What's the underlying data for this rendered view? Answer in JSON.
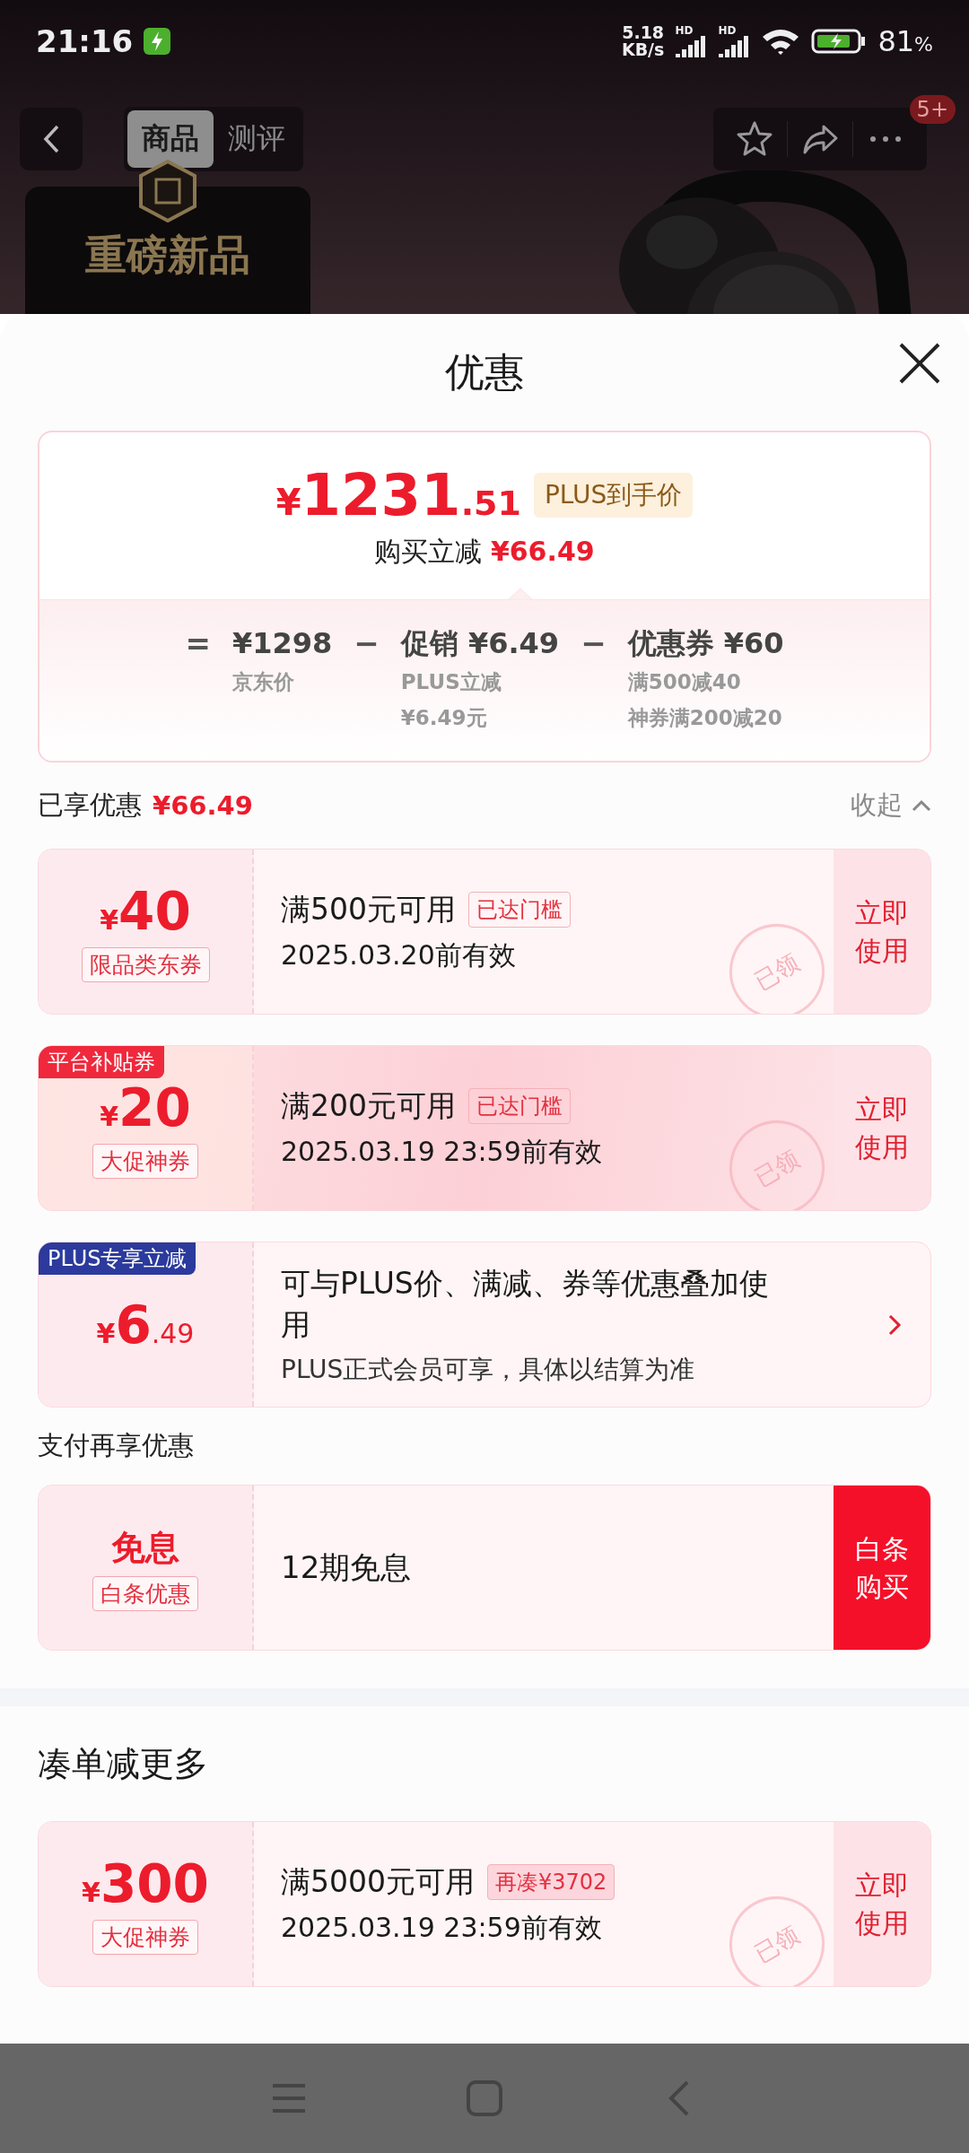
{
  "status_bar": {
    "time": "21:16",
    "net_speed": "5.18",
    "net_unit": "KB/s",
    "signal_labels": [
      "HD",
      "HD"
    ],
    "battery_text": "81",
    "battery_unit": "%"
  },
  "header": {
    "tabs": [
      {
        "label": "商品",
        "selected": true
      },
      {
        "label": "测评",
        "selected": false
      }
    ],
    "promo": "重磅新品",
    "badge": "5+"
  },
  "sheet": {
    "title": "优惠",
    "summary": {
      "currency": "¥",
      "price": "1231",
      "price_decimals": ".51",
      "price_tag": "PLUS到手价",
      "saving_label": "购买立减",
      "saving": "¥66.49",
      "breakdown": [
        {
          "op": "=",
          "value": "¥1298",
          "notes": [
            "京东价"
          ]
        },
        {
          "op": "−",
          "value": "促销 ¥6.49",
          "notes": [
            "PLUS立减",
            "¥6.49元"
          ]
        },
        {
          "op": "−",
          "value": "优惠券 ¥60",
          "notes": [
            "满500减40",
            "神券满200减20"
          ]
        }
      ]
    },
    "enjoyed": {
      "label": "已享优惠",
      "amount": "¥66.49",
      "toggle": "收起",
      "expanded": true
    },
    "offers": [
      {
        "kind": "coupon",
        "currency": "¥",
        "amount": "40",
        "tag": "限品类东券",
        "condition": "满500元可用",
        "badge": {
          "text": "已达门槛",
          "kind": "outline"
        },
        "validity": "2025.03.20前有效",
        "action": "立即使用",
        "stamp": "已领",
        "featured": false
      },
      {
        "kind": "coupon",
        "ribbon": {
          "text": "平台补贴券",
          "color": "#f0283c"
        },
        "currency": "¥",
        "amount": "20",
        "tag": "大促神券",
        "condition": "满200元可用",
        "badge": {
          "text": "已达门槛",
          "kind": "outline"
        },
        "validity": "2025.03.19 23:59前有效",
        "action": "立即使用",
        "stamp": "已领",
        "featured": true
      },
      {
        "kind": "plus",
        "ribbon": {
          "text": "PLUS专享立减",
          "color": "#2b3a9c"
        },
        "currency": "¥",
        "amount": "6",
        "decimals": ".49",
        "description": "可与PLUS价、满减、券等优惠叠加使用",
        "note": "PLUS正式会员可享，具体以结算为准"
      }
    ],
    "pay_title": "支付再享优惠",
    "pay_offers": [
      {
        "kind": "pay",
        "title": "免息",
        "tag": "白条优惠",
        "text": "12期免息",
        "action": "白条购买"
      }
    ],
    "bundle_title": "凑单减更多",
    "bundle_offers": [
      {
        "kind": "coupon",
        "currency": "¥",
        "amount": "300",
        "tag": "大促神券",
        "condition": "满5000元可用",
        "badge": {
          "text": "再凑¥3702",
          "kind": "filled"
        },
        "validity": "2025.03.19 23:59前有效",
        "action": "立即使用",
        "stamp": "已领",
        "featured": false
      }
    ]
  }
}
